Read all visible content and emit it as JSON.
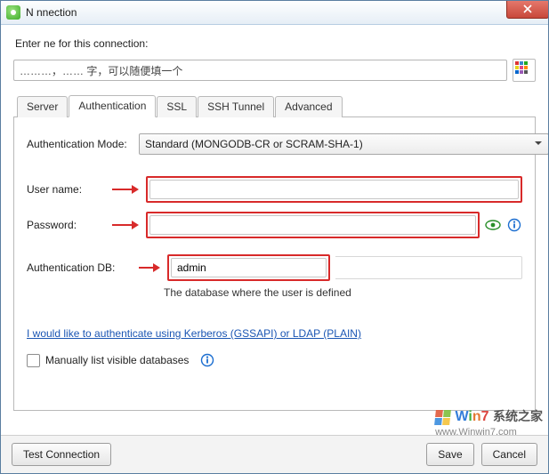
{
  "window": {
    "title": "N        nnection"
  },
  "prompt": "Enter         ne for this connection:",
  "connection_name": "………，…… 字，可以随便填一个",
  "tabs": [
    "Server",
    "Authentication",
    "SSL",
    "SSH Tunnel",
    "Advanced"
  ],
  "active_tab": 1,
  "auth": {
    "mode_label": "Authentication Mode:",
    "mode_value": "Standard (MONGODB-CR or SCRAM-SHA-1)",
    "user_label": "User name:",
    "user_value": "",
    "password_label": "Password:",
    "password_value": "",
    "authdb_label": "Authentication DB:",
    "authdb_value": "admin",
    "authdb_hint": "The database where the user is defined",
    "kerberos_link": "I would like to authenticate using Kerberos (GSSAPI) or LDAP (PLAIN)",
    "manual_list_label": "Manually list visible databases",
    "manual_list_checked": false
  },
  "footer": {
    "test": "Test Connection",
    "save": "Save",
    "cancel": "Cancel"
  },
  "watermark": {
    "brand_latin": "Win",
    "brand_num": "7",
    "brand_cn": "系统之家",
    "url": "www.Winwin7.com"
  },
  "palette_colors": [
    "#d33",
    "#38c",
    "#2a2",
    "#e7d21c",
    "#d48",
    "#f80",
    "#06c",
    "#9b59b6",
    "#555"
  ]
}
